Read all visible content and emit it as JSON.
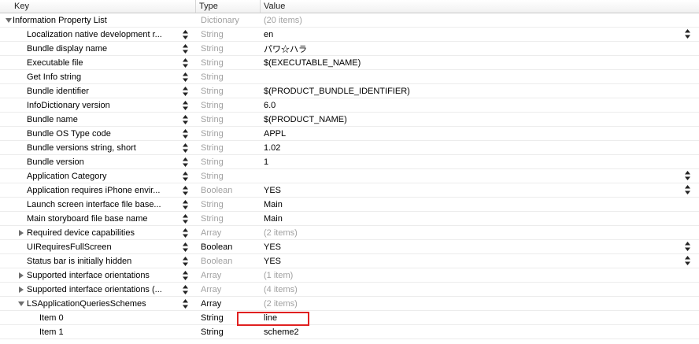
{
  "header": {
    "key_label": "Key",
    "type_label": "Type",
    "value_label": "Value"
  },
  "rows": [
    {
      "key": "Information Property List",
      "type": "Dictionary",
      "value": "(20 items)"
    },
    {
      "key": "Localization native development r...",
      "type": "String",
      "value": "en"
    },
    {
      "key": "Bundle display name",
      "type": "String",
      "value": "パワ☆ハラ"
    },
    {
      "key": "Executable file",
      "type": "String",
      "value": "$(EXECUTABLE_NAME)"
    },
    {
      "key": "Get Info string",
      "type": "String",
      "value": ""
    },
    {
      "key": "Bundle identifier",
      "type": "String",
      "value": "$(PRODUCT_BUNDLE_IDENTIFIER)"
    },
    {
      "key": "InfoDictionary version",
      "type": "String",
      "value": "6.0"
    },
    {
      "key": "Bundle name",
      "type": "String",
      "value": "$(PRODUCT_NAME)"
    },
    {
      "key": "Bundle OS Type code",
      "type": "String",
      "value": "APPL"
    },
    {
      "key": "Bundle versions string, short",
      "type": "String",
      "value": "1.02"
    },
    {
      "key": "Bundle version",
      "type": "String",
      "value": "1"
    },
    {
      "key": "Application Category",
      "type": "String",
      "value": ""
    },
    {
      "key": "Application requires iPhone envir...",
      "type": "Boolean",
      "value": "YES"
    },
    {
      "key": "Launch screen interface file base...",
      "type": "String",
      "value": "Main"
    },
    {
      "key": "Main storyboard file base name",
      "type": "String",
      "value": "Main"
    },
    {
      "key": "Required device capabilities",
      "type": "Array",
      "value": "(2 items)"
    },
    {
      "key": "UIRequiresFullScreen",
      "type": "Boolean",
      "value": "YES"
    },
    {
      "key": "Status bar is initially hidden",
      "type": "Boolean",
      "value": "YES"
    },
    {
      "key": "Supported interface orientations",
      "type": "Array",
      "value": "(1 item)"
    },
    {
      "key": "Supported interface orientations (...",
      "type": "Array",
      "value": "(4 items)"
    },
    {
      "key": "LSApplicationQueriesSchemes",
      "type": "Array",
      "value": "(2 items)"
    },
    {
      "key": "Item 0",
      "type": "String",
      "value": "line"
    },
    {
      "key": "Item 1",
      "type": "String",
      "value": "scheme2"
    }
  ],
  "colors": {
    "annotation_box": "#e02020",
    "muted_text": "#a1a1a1",
    "grid": "#ececec"
  }
}
